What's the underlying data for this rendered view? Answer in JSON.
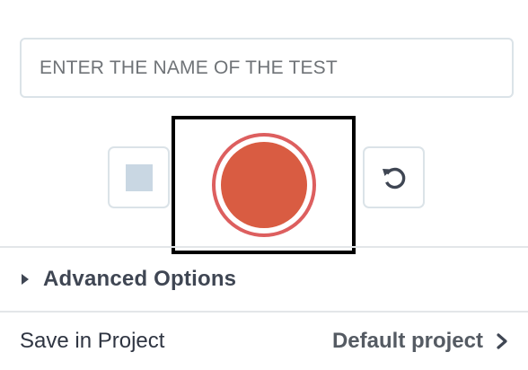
{
  "test_name": {
    "value": "",
    "placeholder": "ENTER THE NAME OF THE TEST"
  },
  "controls": {
    "stop_icon": "stop-square-icon",
    "record_icon": "record-circle-icon",
    "reset_icon": "rotate-ccw-icon"
  },
  "colors": {
    "record": "#d95c42",
    "record_ring": "#dd5f5f",
    "stop": "#c9d7e3",
    "border": "#dbe3e8",
    "text": "#3f4653"
  },
  "advanced": {
    "label": "Advanced Options"
  },
  "project": {
    "label": "Save in Project",
    "value": "Default project"
  }
}
